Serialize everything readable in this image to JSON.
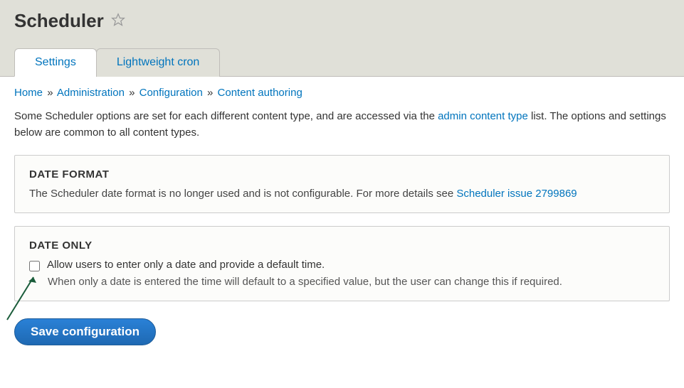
{
  "page_title": "Scheduler",
  "tabs": {
    "settings": "Settings",
    "lightweight_cron": "Lightweight cron"
  },
  "breadcrumbs": {
    "home": "Home",
    "administration": "Administration",
    "configuration": "Configuration",
    "content_authoring": "Content authoring"
  },
  "intro": {
    "part1": "Some Scheduler options are set for each different content type, and are accessed via the ",
    "link": "admin content type",
    "part2": " list. The options and settings below are common to all content types."
  },
  "date_format": {
    "legend": "DATE FORMAT",
    "desc": "The Scheduler date format is no longer used and is not configurable. For more details see ",
    "link": "Scheduler issue 2799869"
  },
  "date_only": {
    "legend": "DATE ONLY",
    "checkbox_label": "Allow users to enter only a date and provide a default time.",
    "help": "When only a date is entered the time will default to a specified value, but the user can change this if required."
  },
  "save_button": "Save configuration"
}
